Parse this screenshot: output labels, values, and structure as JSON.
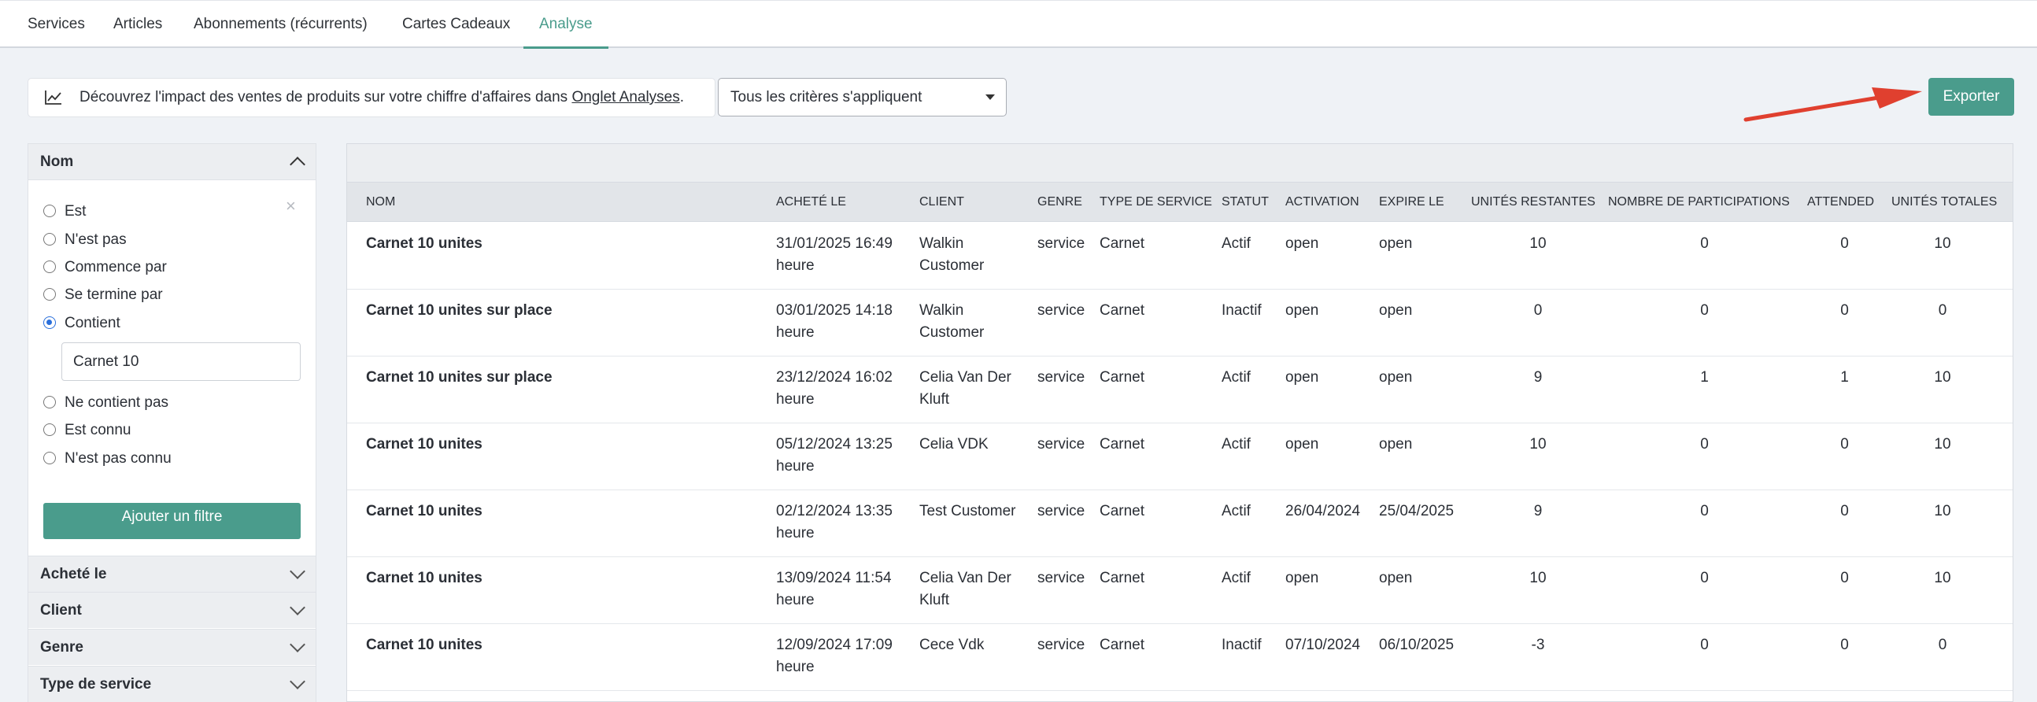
{
  "tabs": [
    {
      "label": "Services",
      "active": false
    },
    {
      "label": "Articles",
      "active": false
    },
    {
      "label": "Abonnements (récurrents)",
      "active": false
    },
    {
      "label": "Cartes Cadeaux",
      "active": false
    },
    {
      "label": "Analyse",
      "active": true
    }
  ],
  "info": {
    "text": "Découvrez l'impact des ventes de produits sur votre chiffre d'affaires dans ",
    "link": "Onglet Analyses",
    "suffix": "."
  },
  "criteria_select": {
    "value": "Tous les critères s'appliquent"
  },
  "export_label": "Exporter",
  "filter": {
    "section_title": "Nom",
    "close_glyph": "×",
    "options": [
      {
        "label": "Est",
        "checked": false
      },
      {
        "label": "N'est pas",
        "checked": false
      },
      {
        "label": "Commence par",
        "checked": false
      },
      {
        "label": "Se termine par",
        "checked": false
      },
      {
        "label": "Contient",
        "checked": true
      },
      {
        "label": "Ne contient pas",
        "checked": false
      },
      {
        "label": "Est connu",
        "checked": false
      },
      {
        "label": "N'est pas connu",
        "checked": false
      }
    ],
    "input_value": "Carnet 10",
    "add_filter_label": "Ajouter un filtre",
    "sections": [
      "Acheté le",
      "Client",
      "Genre",
      "Type de service"
    ]
  },
  "table": {
    "headers": [
      "NOM",
      "ACHETÉ LE",
      "CLIENT",
      "GENRE",
      "TYPE DE SERVICE",
      "STATUT",
      "ACTIVATION",
      "EXPIRE LE",
      "UNITÉS RESTANTES",
      "NOMBRE DE PARTICIPATIONS",
      "ATTENDED",
      "UNITÉS TOTALES"
    ],
    "rows": [
      {
        "nom": "Carnet 10 unites",
        "achete1": "31/01/2025 16:49",
        "achete2": "heure",
        "client1": "Walkin",
        "client2": "Customer",
        "genre": "service",
        "type": "Carnet",
        "statut": "Actif",
        "activation": "open",
        "expire": "open",
        "restantes": "10",
        "participations": "0",
        "attended": "0",
        "totales": "10"
      },
      {
        "nom": "Carnet 10 unites sur place",
        "achete1": "03/01/2025 14:18",
        "achete2": "heure",
        "client1": "Walkin",
        "client2": "Customer",
        "genre": "service",
        "type": "Carnet",
        "statut": "Inactif",
        "activation": "open",
        "expire": "open",
        "restantes": "0",
        "participations": "0",
        "attended": "0",
        "totales": "0"
      },
      {
        "nom": "Carnet 10 unites sur place",
        "achete1": "23/12/2024 16:02",
        "achete2": "heure",
        "client1": "Celia Van Der",
        "client2": "Kluft",
        "genre": "service",
        "type": "Carnet",
        "statut": "Actif",
        "activation": "open",
        "expire": "open",
        "restantes": "9",
        "participations": "1",
        "attended": "1",
        "totales": "10"
      },
      {
        "nom": "Carnet 10 unites",
        "achete1": "05/12/2024 13:25",
        "achete2": "heure",
        "client1": "Celia VDK",
        "client2": "",
        "genre": "service",
        "type": "Carnet",
        "statut": "Actif",
        "activation": "open",
        "expire": "open",
        "restantes": "10",
        "participations": "0",
        "attended": "0",
        "totales": "10"
      },
      {
        "nom": "Carnet 10 unites",
        "achete1": "02/12/2024 13:35",
        "achete2": "heure",
        "client1": "Test Customer",
        "client2": "",
        "genre": "service",
        "type": "Carnet",
        "statut": "Actif",
        "activation": "26/04/2024",
        "expire": "25/04/2025",
        "restantes": "9",
        "participations": "0",
        "attended": "0",
        "totales": "10"
      },
      {
        "nom": "Carnet 10 unites",
        "achete1": "13/09/2024 11:54",
        "achete2": "heure",
        "client1": "Celia Van Der",
        "client2": "Kluft",
        "genre": "service",
        "type": "Carnet",
        "statut": "Actif",
        "activation": "open",
        "expire": "open",
        "restantes": "10",
        "participations": "0",
        "attended": "0",
        "totales": "10"
      },
      {
        "nom": "Carnet 10 unites",
        "achete1": "12/09/2024 17:09",
        "achete2": "heure",
        "client1": "Cece Vdk",
        "client2": "",
        "genre": "service",
        "type": "Carnet",
        "statut": "Inactif",
        "activation": "07/10/2024",
        "expire": "06/10/2025",
        "restantes": "-3",
        "participations": "0",
        "attended": "0",
        "totales": "0"
      }
    ]
  },
  "colors": {
    "accent": "#4a9c8c",
    "arrow": "#e0402f",
    "radio_checked": "#2a6fdb"
  }
}
